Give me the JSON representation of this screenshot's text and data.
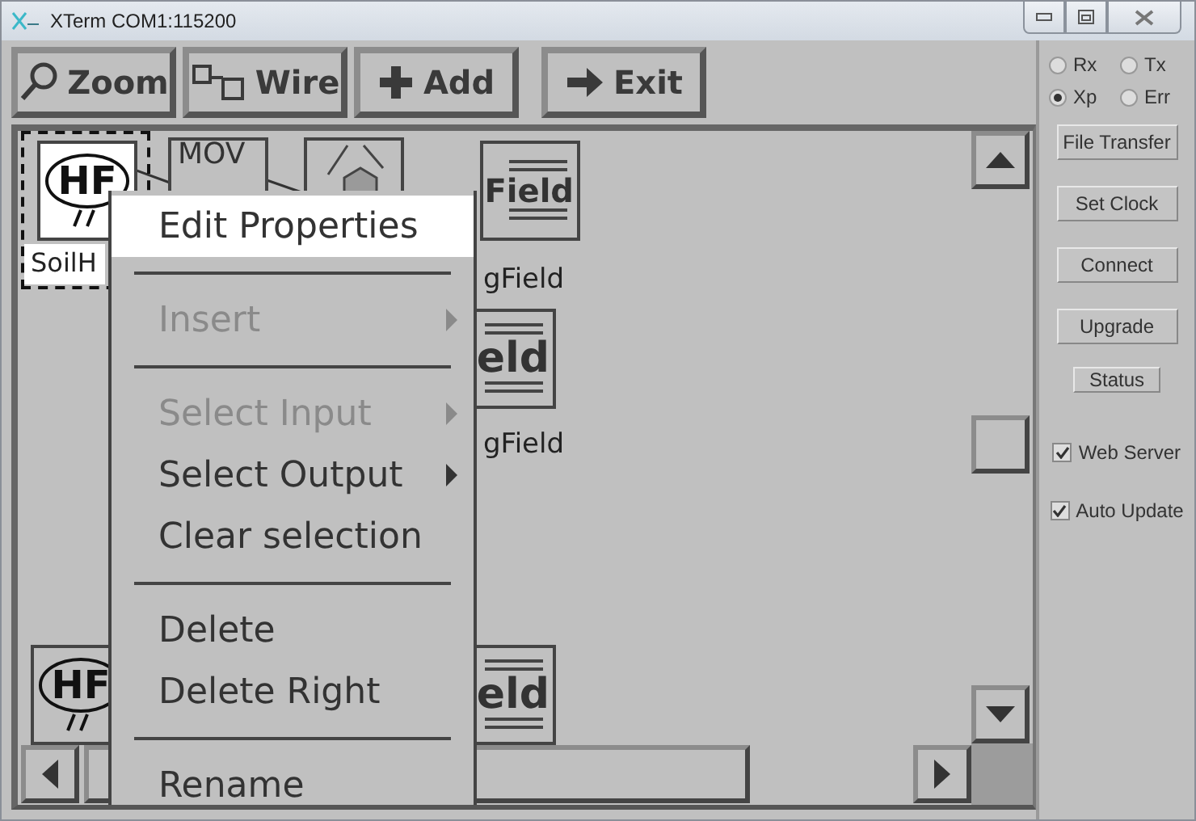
{
  "window": {
    "title": "XTerm COM1:115200"
  },
  "toolbar": [
    {
      "kind": "zoom",
      "label": "Zoom"
    },
    {
      "kind": "wire",
      "label": "Wire"
    },
    {
      "kind": "add",
      "label": "Add"
    },
    {
      "kind": "exit",
      "label": "Exit"
    }
  ],
  "canvas": {
    "nodes": [
      {
        "kind": "hf",
        "text": "HF",
        "label": "SoilH",
        "selected": true
      },
      {
        "kind": "mov",
        "text": "MOV",
        "selected": false
      },
      {
        "kind": "relay",
        "selected": false
      },
      {
        "kind": "field",
        "text": "Field",
        "label": "gField",
        "selected": false
      },
      {
        "kind": "field",
        "text": "eld",
        "label": "gField",
        "selected": false
      },
      {
        "kind": "hf",
        "text": "HF",
        "selected": false
      },
      {
        "kind": "field",
        "text": "eld",
        "selected": false
      }
    ]
  },
  "context_menu": [
    {
      "kind": "item",
      "label": "Edit Properties",
      "selected": true,
      "disabled": false,
      "submenu": false
    },
    {
      "kind": "separator"
    },
    {
      "kind": "item",
      "label": "Insert",
      "selected": false,
      "disabled": true,
      "submenu": true
    },
    {
      "kind": "separator"
    },
    {
      "kind": "item",
      "label": "Select Input",
      "selected": false,
      "disabled": true,
      "submenu": true
    },
    {
      "kind": "item",
      "label": "Select Output",
      "selected": false,
      "disabled": false,
      "submenu": true
    },
    {
      "kind": "item",
      "label": "Clear selection",
      "selected": false,
      "disabled": false,
      "submenu": false
    },
    {
      "kind": "separator"
    },
    {
      "kind": "item",
      "label": "Delete",
      "selected": false,
      "disabled": false,
      "submenu": false
    },
    {
      "kind": "item",
      "label": "Delete Right",
      "selected": false,
      "disabled": false,
      "submenu": false
    },
    {
      "kind": "separator"
    },
    {
      "kind": "item",
      "label": "Rename",
      "selected": false,
      "disabled": false,
      "submenu": false
    }
  ],
  "side_panel": {
    "radios": [
      {
        "label": "Rx",
        "selected": false
      },
      {
        "label": "Tx",
        "selected": false
      },
      {
        "label": "Xp",
        "selected": true
      },
      {
        "label": "Err",
        "selected": false
      }
    ],
    "buttons": [
      {
        "label": "File Transfer"
      },
      {
        "label": "Set Clock"
      },
      {
        "label": "Connect"
      },
      {
        "label": "Upgrade"
      },
      {
        "label": "Status"
      }
    ],
    "checkboxes": [
      {
        "label": "Web Server",
        "checked": true
      },
      {
        "label": "Auto Update",
        "checked": true
      }
    ]
  }
}
